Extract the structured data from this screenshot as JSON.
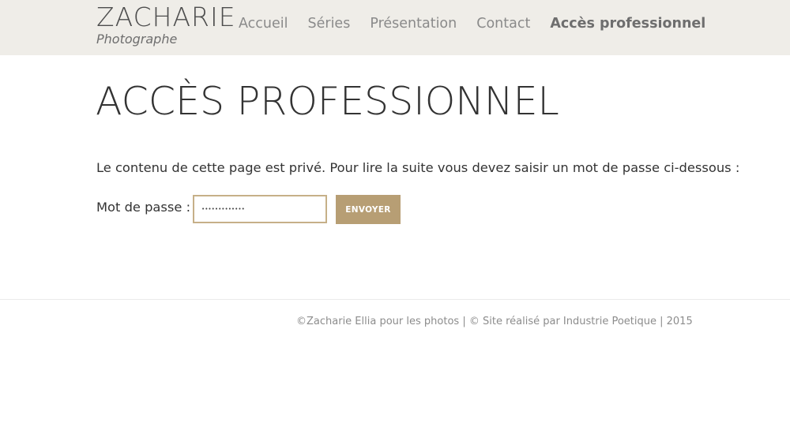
{
  "header": {
    "logo": {
      "name": "ZACHARIE",
      "subtitle": "Photographe"
    },
    "nav": [
      {
        "label": "Accueil",
        "active": false
      },
      {
        "label": "Séries",
        "active": false
      },
      {
        "label": "Présentation",
        "active": false
      },
      {
        "label": "Contact",
        "active": false
      },
      {
        "label": "Accès professionnel",
        "active": true
      }
    ]
  },
  "main": {
    "title": "ACCÈS PROFESSIONNEL",
    "intro": "Le contenu de cette page est privé. Pour lire la suite vous devez saisir un mot de passe ci-dessous :",
    "password_label": "Mot de passe :",
    "password_value": "•••••••••••••",
    "submit_label": "ENVOYER"
  },
  "footer": {
    "credit_photos": "©Zacharie Ellia pour les photos",
    "separator_1": "|",
    "copyright_symbol": "©",
    "credit_site": "Site réalisé par Industrie Poetique",
    "separator_2": "|",
    "year": "2015"
  },
  "colors": {
    "header_bg": "#efede8",
    "accent": "#b79e74",
    "input_border": "#c6b088",
    "text": "#333333",
    "nav_text": "#8a8a8a",
    "footer_text": "#8c8c8c"
  }
}
